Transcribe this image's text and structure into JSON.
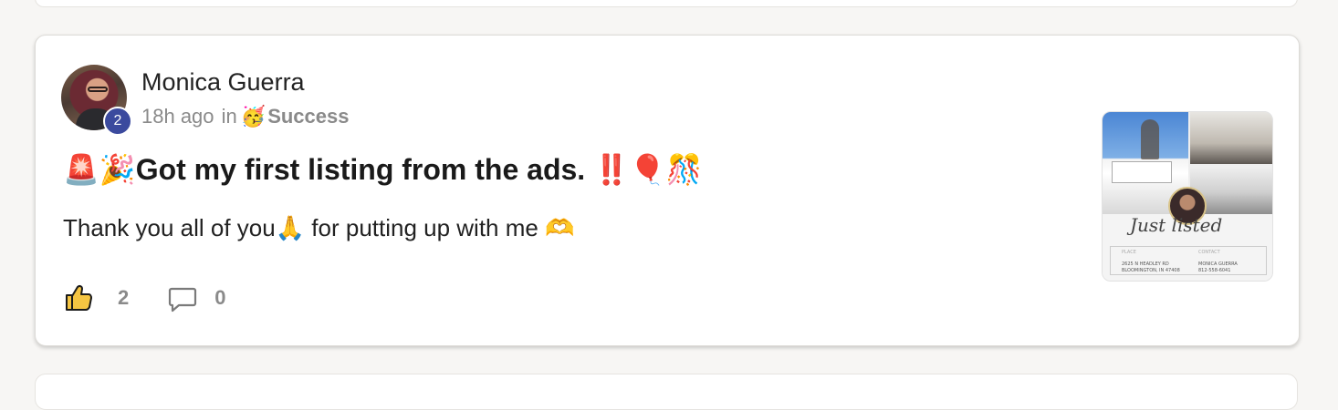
{
  "post": {
    "author": "Monica Guerra",
    "level": "2",
    "time": "18h ago",
    "in_word": "in",
    "category_emoji": "🥳",
    "category": "Success",
    "title": "🚨🎉Got my first listing from the ads. ‼️🎈🎊",
    "body": "Thank you all of you🙏 for putting up with me 🫶",
    "likes": "2",
    "comments": "0"
  },
  "thumbnail": {
    "script_text": "Just listed",
    "place_label": "PLACE",
    "place_line1": "2625 N HEADLEY RD",
    "place_line2": "BLOOMINGTON, IN 47408",
    "contact_label": "CONTACT",
    "contact_name": "MONICA GUERRA",
    "contact_phone": "812-558-6041"
  },
  "colors": {
    "level_badge": "#3b4a9e",
    "meta_gray": "#8a8a8a",
    "card_bg": "#ffffff",
    "page_bg": "#f7f6f4"
  }
}
